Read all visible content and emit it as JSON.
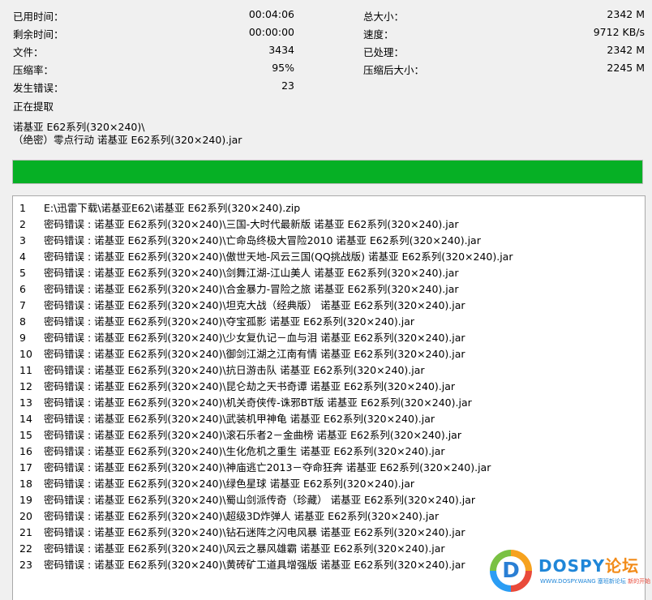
{
  "stats": {
    "left": [
      {
        "label": "已用时间：",
        "value": "00:04:06"
      },
      {
        "label": "剩余时间：",
        "value": "00:00:00"
      },
      {
        "label": "文件：",
        "value": "3434"
      },
      {
        "label": "压缩率：",
        "value": "95%"
      },
      {
        "label": "发生错误：",
        "value": "23"
      }
    ],
    "right": [
      {
        "label": "总大小：",
        "value": "2342 M"
      },
      {
        "label": "速度：",
        "value": "9712 KB/s"
      },
      {
        "label": "已处理：",
        "value": "2342 M"
      },
      {
        "label": "压缩后大小：",
        "value": "2245 M"
      }
    ]
  },
  "status": {
    "action": "正在提取",
    "folder": "诺基亚 E62系列(320×240)\\",
    "file": "（绝密）零点行动 诺基亚 E62系列(320×240).jar"
  },
  "progress": {
    "fraction": 1.0,
    "color": "#06b025"
  },
  "log": [
    {
      "n": "1",
      "text": "E:\\迅雷下载\\诺基亚E62\\诺基亚 E62系列(320×240).zip"
    },
    {
      "n": "2",
      "text": "密码错误 : 诺基亚 E62系列(320×240)\\三国-大时代最新版 诺基亚 E62系列(320×240).jar"
    },
    {
      "n": "3",
      "text": "密码错误 : 诺基亚 E62系列(320×240)\\亡命岛终极大冒险2010 诺基亚 E62系列(320×240).jar"
    },
    {
      "n": "4",
      "text": "密码错误 : 诺基亚 E62系列(320×240)\\傲世天地-风云三国(QQ挑战版) 诺基亚 E62系列(320×240).jar"
    },
    {
      "n": "5",
      "text": "密码错误 : 诺基亚 E62系列(320×240)\\剑舞江湖-江山美人 诺基亚 E62系列(320×240).jar"
    },
    {
      "n": "6",
      "text": "密码错误 : 诺基亚 E62系列(320×240)\\合金暴力-冒险之旅 诺基亚 E62系列(320×240).jar"
    },
    {
      "n": "7",
      "text": "密码错误 : 诺基亚 E62系列(320×240)\\坦克大战（经典版） 诺基亚 E62系列(320×240).jar"
    },
    {
      "n": "8",
      "text": "密码错误 : 诺基亚 E62系列(320×240)\\夺宝孤影 诺基亚 E62系列(320×240).jar"
    },
    {
      "n": "9",
      "text": "密码错误 : 诺基亚 E62系列(320×240)\\少女复仇记－血与泪 诺基亚 E62系列(320×240).jar"
    },
    {
      "n": "10",
      "text": "密码错误 : 诺基亚 E62系列(320×240)\\御剑江湖之江南有情 诺基亚 E62系列(320×240).jar"
    },
    {
      "n": "11",
      "text": "密码错误 : 诺基亚 E62系列(320×240)\\抗日游击队 诺基亚 E62系列(320×240).jar"
    },
    {
      "n": "12",
      "text": "密码错误 : 诺基亚 E62系列(320×240)\\昆仑劫之天书奇谭 诺基亚 E62系列(320×240).jar"
    },
    {
      "n": "13",
      "text": "密码错误 : 诺基亚 E62系列(320×240)\\机关奇侠传-诛邪BT版 诺基亚 E62系列(320×240).jar"
    },
    {
      "n": "14",
      "text": "密码错误 : 诺基亚 E62系列(320×240)\\武装机甲神龟 诺基亚 E62系列(320×240).jar"
    },
    {
      "n": "15",
      "text": "密码错误 : 诺基亚 E62系列(320×240)\\滚石乐者2－金曲榜 诺基亚 E62系列(320×240).jar"
    },
    {
      "n": "16",
      "text": "密码错误 : 诺基亚 E62系列(320×240)\\生化危机之重生 诺基亚 E62系列(320×240).jar"
    },
    {
      "n": "17",
      "text": "密码错误 : 诺基亚 E62系列(320×240)\\神庙逃亡2013－夺命狂奔 诺基亚 E62系列(320×240).jar"
    },
    {
      "n": "18",
      "text": "密码错误 : 诺基亚 E62系列(320×240)\\绿色星球 诺基亚 E62系列(320×240).jar"
    },
    {
      "n": "19",
      "text": "密码错误 : 诺基亚 E62系列(320×240)\\蜀山剑派传奇（珍藏） 诺基亚 E62系列(320×240).jar"
    },
    {
      "n": "20",
      "text": "密码错误 : 诺基亚 E62系列(320×240)\\超级3D炸弹人 诺基亚 E62系列(320×240).jar"
    },
    {
      "n": "21",
      "text": "密码错误 : 诺基亚 E62系列(320×240)\\钻石迷阵之闪电风暴 诺基亚 E62系列(320×240).jar"
    },
    {
      "n": "22",
      "text": "密码错误 : 诺基亚 E62系列(320×240)\\风云之暴风雄霸 诺基亚 E62系列(320×240).jar"
    },
    {
      "n": "23",
      "text": "密码错误 : 诺基亚 E62系列(320×240)\\黄砖矿工道具增强版 诺基亚 E62系列(320×240).jar"
    }
  ],
  "watermark": {
    "logo_letter": "D",
    "brand": "DOSPY",
    "brand_suffix": "论坛",
    "url": "WWW.DOSPY.WANG",
    "tagline": "塞班新论坛",
    "tagline2": "新的开始"
  }
}
